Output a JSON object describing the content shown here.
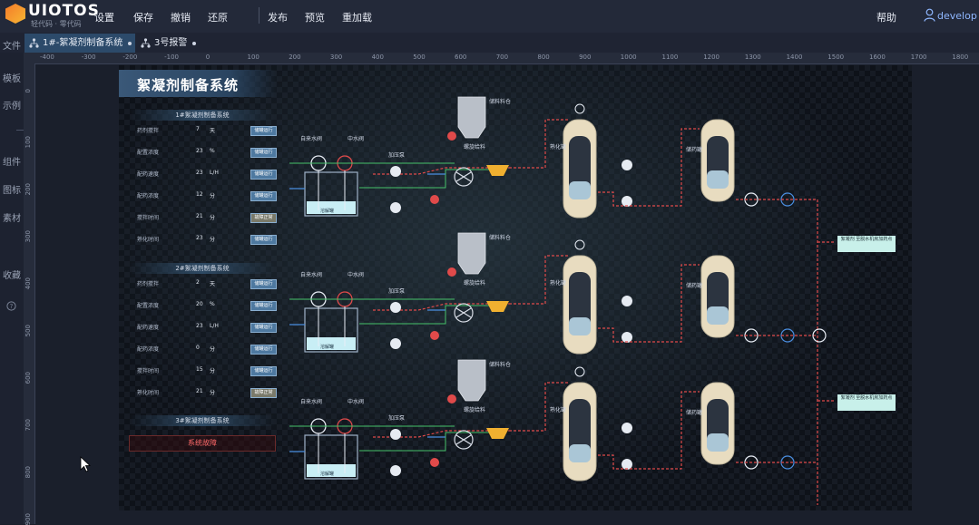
{
  "app": {
    "name": "UIOTOS",
    "subtitle": "轻代码 · 零代码"
  },
  "menu": {
    "settings": "设置",
    "save": "保存",
    "undo": "撤销",
    "redo": "还原",
    "publish": "发布",
    "preview": "预览",
    "reload": "重加载",
    "help": "帮助"
  },
  "user": {
    "name": "develop"
  },
  "sidebar": {
    "items": [
      "文件",
      "模板",
      "示例",
      "组件",
      "图标",
      "素材",
      "收藏"
    ]
  },
  "tabs": [
    {
      "label": "1#-絮凝剂制备系统"
    },
    {
      "label": "3号报警"
    }
  ],
  "ruler": {
    "h": [
      "-400",
      "-300",
      "-200",
      "-100",
      "0",
      "100",
      "200",
      "300",
      "400",
      "500",
      "600",
      "700",
      "800",
      "900",
      "1000",
      "1100",
      "1200",
      "1300",
      "1400",
      "1500",
      "1600",
      "1700",
      "1800"
    ],
    "v": [
      "0",
      "100",
      "200",
      "300",
      "400",
      "500",
      "600",
      "700",
      "800",
      "900"
    ]
  },
  "canvas": {
    "title": "絮凝剂制备系统",
    "panels": [
      {
        "title": "1#絮凝剂制备系统",
        "rows": [
          {
            "label": "药剂搅拌",
            "value": "7",
            "unit": "天",
            "button": "储罐运行"
          },
          {
            "label": "配置浓度",
            "value": "23",
            "unit": "%",
            "button": "储罐运行"
          },
          {
            "label": "配药速度",
            "value": "23",
            "unit": "L/H",
            "button": "储罐运行"
          },
          {
            "label": "配药浓度",
            "value": "12",
            "unit": "分",
            "button": "储罐运行"
          },
          {
            "label": "搅拌时间",
            "value": "21",
            "unit": "分",
            "button": "故障正常"
          },
          {
            "label": "熟化时间",
            "value": "23",
            "unit": "分",
            "button": "储罐运行"
          }
        ]
      },
      {
        "title": "2#絮凝剂制备系统",
        "rows": [
          {
            "label": "药剂搅拌",
            "value": "2",
            "unit": "天",
            "button": "储罐运行"
          },
          {
            "label": "配置浓度",
            "value": "20",
            "unit": "%",
            "button": "储罐运行"
          },
          {
            "label": "配药速度",
            "value": "23",
            "unit": "L/H",
            "button": "储罐运行"
          },
          {
            "label": "配药浓度",
            "value": "0",
            "unit": "分",
            "button": "储罐运行"
          },
          {
            "label": "搅拌时间",
            "value": "15",
            "unit": "分",
            "button": "储罐运行"
          },
          {
            "label": "熟化时间",
            "value": "21",
            "unit": "分",
            "button": "故障正常"
          }
        ]
      },
      {
        "title": "3#絮凝剂制备系统",
        "rows": []
      }
    ],
    "alarm": "系统故障",
    "lines": [
      {
        "inlet": "自来水阀",
        "valve": "中水阀",
        "tank": "溶解罐",
        "pump": "加压泵",
        "fan": "搅拌机",
        "hopper_label": "储料料仓",
        "feeder": "螺旋给料",
        "reactor": "熟化罐",
        "tank_b": "储药罐"
      },
      {
        "inlet": "自来水阀",
        "valve": "中水阀",
        "tank": "溶解罐",
        "pump": "加压泵",
        "fan": "搅拌机",
        "hopper_label": "储料料仓",
        "feeder": "螺旋给料",
        "reactor": "熟化罐",
        "tank_b": "储药罐"
      },
      {
        "inlet": "自来水阀",
        "valve": "中水阀",
        "tank": "溶解罐",
        "pump": "加压泵",
        "fan": "搅拌机",
        "hopper_label": "储料料仓",
        "feeder": "螺旋给料",
        "reactor": "熟化罐",
        "tank_b": "储药罐"
      }
    ],
    "outlets": [
      {
        "label": "絮凝剂 至脱水机房加药点"
      },
      {
        "label": "絮凝剂 至脱水机房加药点"
      }
    ]
  },
  "colors": {
    "accent": "#2c4a6a",
    "pipe_red": "#e04a4a",
    "pipe_green": "#46c26a",
    "pipe_blue": "#4a8ee0",
    "button": "#4e79a0"
  }
}
